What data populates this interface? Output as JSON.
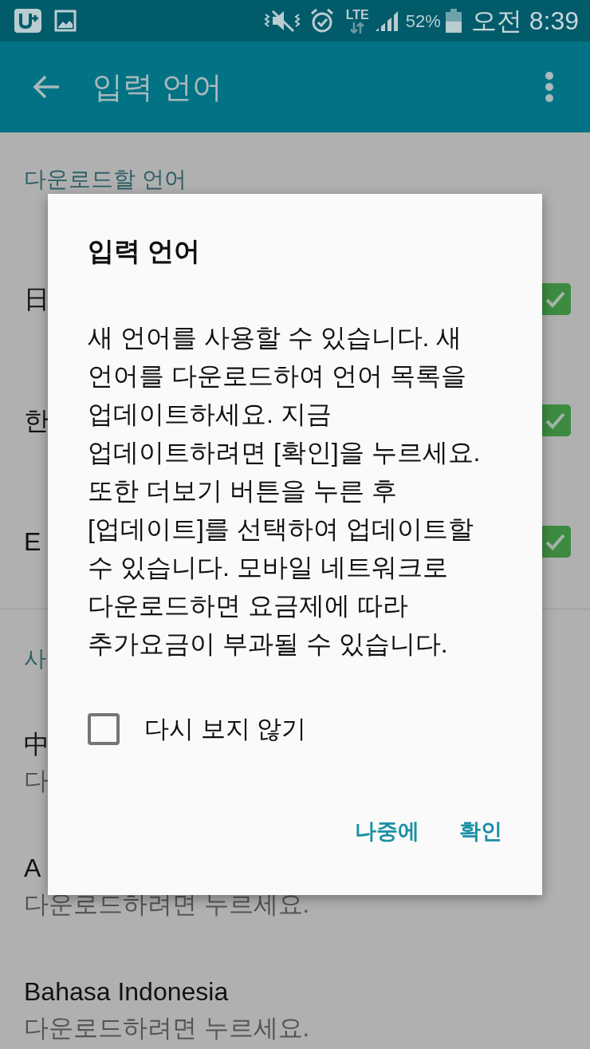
{
  "status_bar": {
    "network": "LTE",
    "battery": "52%",
    "time": "오전 8:39"
  },
  "app_bar": {
    "title": "입력 언어"
  },
  "sections": [
    {
      "header": "다운로드할 언어",
      "items": [
        {
          "label": "日",
          "checked": true
        },
        {
          "label": "한",
          "checked": true
        },
        {
          "label": "E",
          "checked": true
        }
      ]
    },
    {
      "header": "사",
      "items": [
        {
          "label": "中",
          "subtitle": "다"
        },
        {
          "label": "A",
          "subtitle": "다운로드하려면 누르세요."
        },
        {
          "label": "Bahasa Indonesia",
          "subtitle": "다운로드하려면 누르세요."
        }
      ]
    }
  ],
  "dialog": {
    "title": "입력 언어",
    "message": "새 언어를 사용할 수 있습니다. 새 언어를 다운로드하여 언어 목록을 업데이트하세요. 지금 업데이트하려면 [확인]을 누르세요. 또한 더보기 버튼을 누른 후 [업데이트]를 선택하여 업데이트할 수 있습니다. 모바일 네트워크로 다운로드하면 요금제에 따라 추가요금이 부과될 수 있습니다.",
    "checkbox": {
      "label": "다시 보지 않기",
      "checked": false
    },
    "buttons": [
      "나중에",
      "확인"
    ]
  }
}
